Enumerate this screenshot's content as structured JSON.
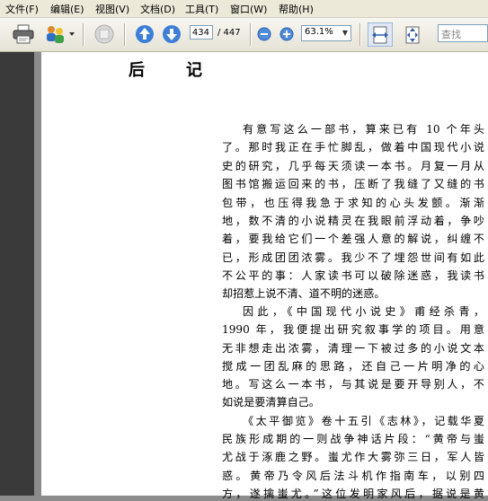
{
  "menu": [
    "文件(F)",
    "编辑(E)",
    "视图(V)",
    "文档(D)",
    "工具(T)",
    "窗口(W)",
    "帮助(H)"
  ],
  "toolbar": {
    "page_current": "434",
    "page_total": "/ 447",
    "zoom": "63.1%",
    "search_placeholder": "查找"
  },
  "document": {
    "title": "后记",
    "lines": [
      "有意写这么一部书，算来已有 10 个年头",
      "了。那时我正在手忙脚乱，做着中国现代小说",
      "史的研究，几乎每天须读一本书。月复一月从",
      "图书馆搬运回来的书，压断了我缝了又缝的书",
      "包带，也压得我急于求知的心头发颤。渐渐",
      "地，数不清的小说精灵在我眼前浮动着，争吵",
      "着，要我给它们一个差强人意的解说，纠缠不",
      "已，形成团团浓雾。我少不了埋怨世间有如此",
      "不公平的事：人家读书可以破除迷惑，我读书",
      "却招惹上说不清、道不明的迷惑。",
      "因此，《中国现代小说史》甫经杀青，",
      "1990 年，我便提出研究叙事学的项目。用意",
      "无非想走出浓雾，清理一下被过多的小说文本",
      "搅成一团乱麻的思路，还自己一片明净的心",
      "地。写这么一本书，与其说是要开导别人，不",
      "如说是要清算自己。",
      "《太平御览》卷十五引《志林》，记载华夏",
      "民族形成期的一则战争神话片段：“黄帝与蚩",
      "尤战于涿鹿之野。蚩尤作大雾弥三日，军人皆",
      "惑。黄帝乃令风后法斗机作指南车，以别四",
      "方，遂擒蚩尤。”这位发明家风后，据说是黄"
    ]
  }
}
